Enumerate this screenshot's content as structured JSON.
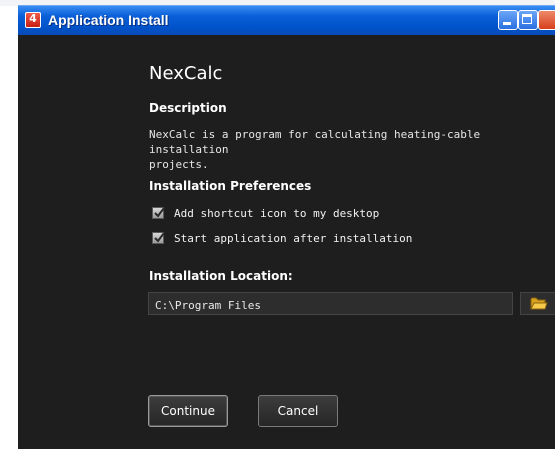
{
  "window": {
    "title": "Application Install"
  },
  "app": {
    "name": "NexCalc"
  },
  "description": {
    "heading": "Description",
    "text": "NexCalc is a program for calculating heating-cable installation\nprojects."
  },
  "preferences": {
    "heading": "Installation Preferences",
    "options": [
      {
        "label": "Add shortcut icon to my desktop",
        "checked": true
      },
      {
        "label": "Start application after installation",
        "checked": true
      }
    ]
  },
  "location": {
    "heading": "Installation Location:",
    "value": "C:\\Program Files"
  },
  "buttons": {
    "continue": "Continue",
    "cancel": "Cancel"
  },
  "icons": {
    "app": "adobe-air-icon",
    "browse": "folder-icon",
    "minimize": "minimize-icon",
    "maximize": "maximize-icon",
    "close": "close-icon"
  },
  "colors": {
    "titlebar": "#0052c9",
    "background": "#1e1e1e",
    "text": "#ffffff",
    "field": "#2d2d2d"
  }
}
